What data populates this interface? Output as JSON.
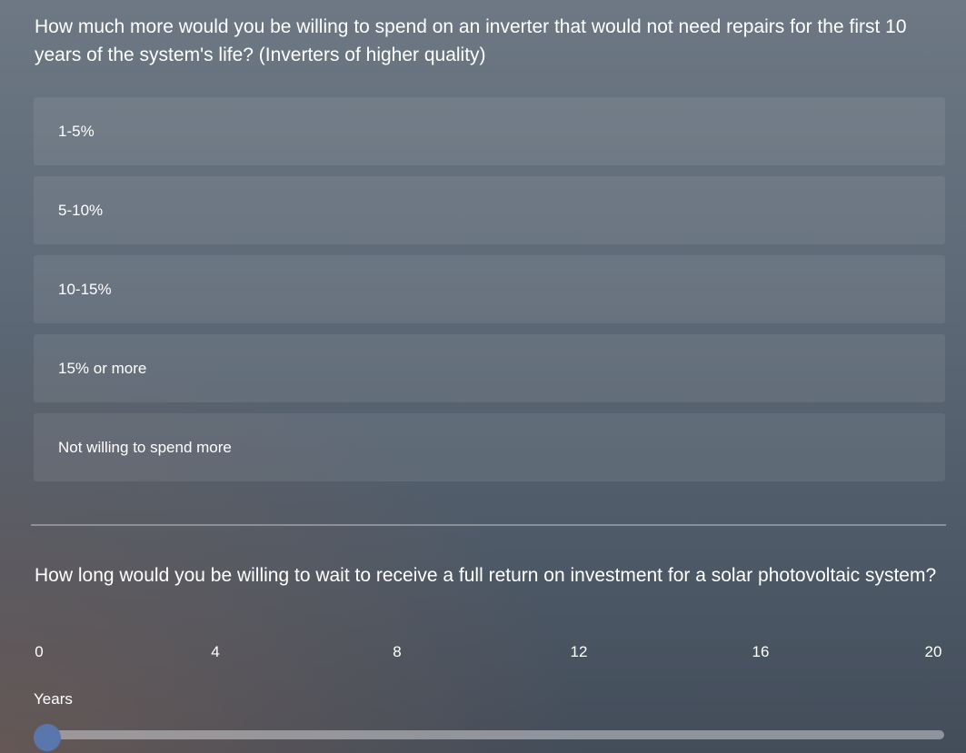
{
  "question1": {
    "title": "How much more would you be willing to spend on an inverter that would not need repairs for the first 10 years of the system's life? (Inverters of higher quality)",
    "options": [
      {
        "label": "1-5%"
      },
      {
        "label": "5-10%"
      },
      {
        "label": "10-15%"
      },
      {
        "label": "15% or more"
      },
      {
        "label": "Not willing to spend more"
      }
    ]
  },
  "question2": {
    "title": "How long would you be willing to wait to receive a full return on investment for a solar photovoltaic system?",
    "slider": {
      "min": 0,
      "max": 20,
      "value": 0,
      "ticks": [
        "0",
        "4",
        "8",
        "12",
        "16",
        "20"
      ],
      "unit_label": "Years"
    }
  },
  "colors": {
    "slider_thumb": "#5a77ad"
  }
}
